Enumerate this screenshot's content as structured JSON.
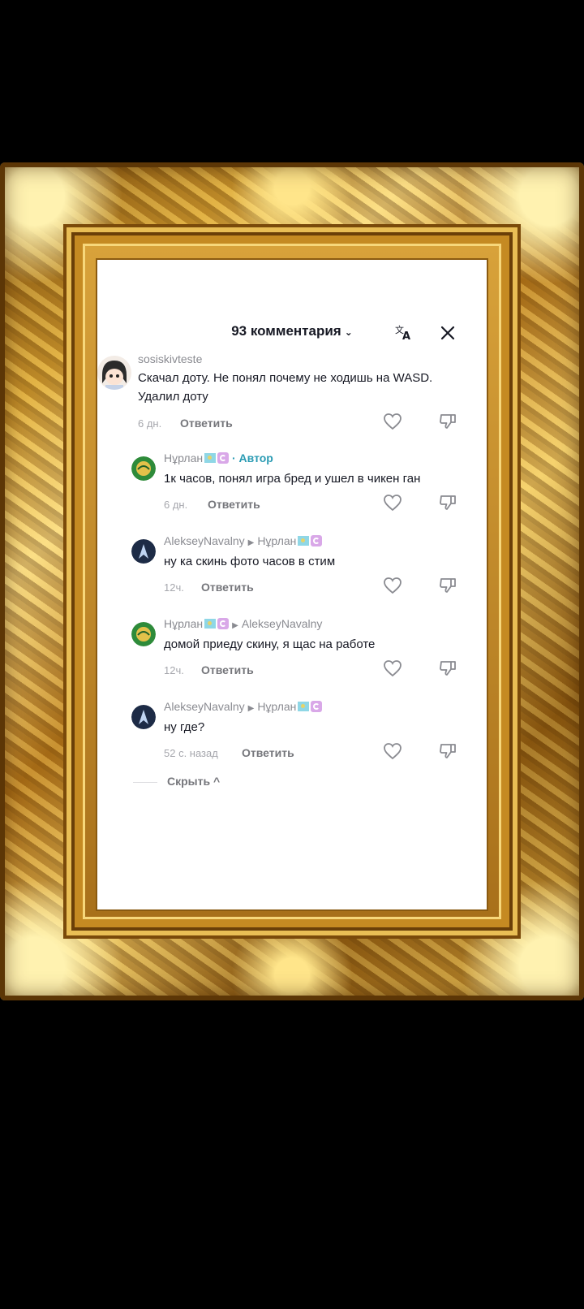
{
  "header": {
    "title": "93 комментария",
    "chevron": "⌄",
    "translate_icon": "translate-icon",
    "close_icon": "close-icon"
  },
  "comments": [
    {
      "username": "sosiskivteste",
      "text_line1": "Скачал доту. Не понял почему не ходишь на WASD.",
      "text_line2": "Удалил доту",
      "time": "6 дн.",
      "reply": "Ответить"
    },
    {
      "username": "Нұрлан",
      "author_badge": "· Автор",
      "text": "1к часов, понял игра бред и ушел в чикен ган",
      "time": "6 дн.",
      "reply": "Ответить"
    },
    {
      "username": "AlekseyNavalny",
      "reply_to": "Нұрлан",
      "text": "ну ка скинь фото часов в стим",
      "time": "12ч.",
      "reply": "Ответить"
    },
    {
      "username": "Нұрлан",
      "reply_to": "AlekseyNavalny",
      "text": "домой приеду скину, я щас на работе",
      "time": "12ч.",
      "reply": "Ответить"
    },
    {
      "username": "AlekseyNavalny",
      "reply_to": "Нұрлан",
      "text": "ну где?",
      "time": "52 с. назад",
      "reply": "Ответить"
    }
  ],
  "footer": {
    "hide_label": "Скрыть ^"
  },
  "colors": {
    "author": "#2a9bb3",
    "text": "#161823",
    "muted": "#8a8b91",
    "frame_gold": "#d9a534"
  }
}
